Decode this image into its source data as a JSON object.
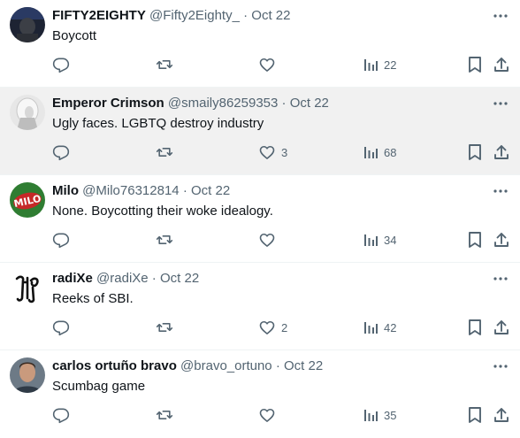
{
  "tweets": [
    {
      "name": "FIFTY2EIGHTY",
      "handle": "@Fifty2Eighty_",
      "dot": "·",
      "time": "Oct 22",
      "text": "Boycott",
      "likes": "",
      "views": "22",
      "highlighted": false,
      "avatar": "dark-blue-portrait"
    },
    {
      "name": "Emperor Crimson",
      "handle": "@smaily86259353",
      "dot": "·",
      "time": "Oct 22",
      "text": "Ugly faces. LGBTQ destroy industry",
      "likes": "3",
      "views": "68",
      "highlighted": true,
      "avatar": "white-haired-figure"
    },
    {
      "name": "Milo",
      "handle": "@Milo76312814",
      "dot": "·",
      "time": "Oct 22",
      "text": "None. Boycotting their woke idealogy.",
      "likes": "",
      "views": "34",
      "highlighted": false,
      "avatar": "milo-logo"
    },
    {
      "name": "radiXe",
      "handle": "@radiXe",
      "dot": "·",
      "time": "Oct 22",
      "text": "Reeks of SBI.",
      "likes": "2",
      "views": "42",
      "highlighted": false,
      "avatar": "gothic-monogram"
    },
    {
      "name": "carlos ortuño bravo",
      "handle": "@bravo_ortuno",
      "dot": "·",
      "time": "Oct 22",
      "text": "Scumbag game",
      "likes": "",
      "views": "35",
      "highlighted": false,
      "avatar": "man-portrait"
    }
  ],
  "icons": {
    "reply": "reply-icon",
    "retweet": "retweet-icon",
    "like": "like-icon",
    "views": "views-icon",
    "bookmark": "bookmark-icon",
    "share": "share-icon",
    "more": "more-icon"
  },
  "colors": {
    "text": "#0f1419",
    "secondary": "#536471",
    "highlight_bg": "#f1f1f1",
    "divider": "#eff3f4"
  }
}
